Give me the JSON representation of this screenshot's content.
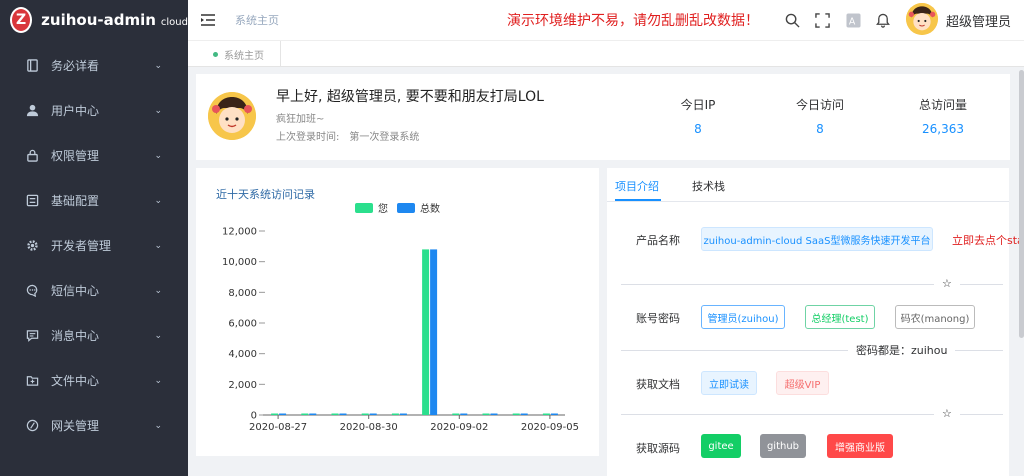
{
  "app": {
    "name": "zuihou-admin",
    "suffix": "cloud",
    "logo_letter": "Z"
  },
  "sidebar": {
    "items": [
      {
        "label": "务必详看",
        "icon": "book-icon"
      },
      {
        "label": "用户中心",
        "icon": "user-icon"
      },
      {
        "label": "权限管理",
        "icon": "lock-icon"
      },
      {
        "label": "基础配置",
        "icon": "config-icon"
      },
      {
        "label": "开发者管理",
        "icon": "gear-icon"
      },
      {
        "label": "短信中心",
        "icon": "sms-icon"
      },
      {
        "label": "消息中心",
        "icon": "message-icon"
      },
      {
        "label": "文件中心",
        "icon": "folder-icon"
      },
      {
        "label": "网关管理",
        "icon": "gateway-icon"
      }
    ]
  },
  "header": {
    "breadcrumb": "系统主页",
    "notice": "演示环境维护不易，请勿乱删乱改数据！",
    "username": "超级管理员",
    "icons": [
      "search-icon",
      "fullscreen-icon",
      "translate-icon",
      "bell-icon"
    ]
  },
  "tagsview": {
    "tags": [
      {
        "label": "系统主页"
      }
    ]
  },
  "welcome": {
    "greeting": "早上好, 超级管理员, 要不要和朋友打局LOL",
    "subtitle": "疯狂加班~",
    "last_login_label": "上次登录时间:",
    "last_login_value": "第一次登录系统",
    "stats": [
      {
        "label": "今日IP",
        "value": "8"
      },
      {
        "label": "今日访问",
        "value": "8"
      },
      {
        "label": "总访问量",
        "value": "26,363"
      }
    ]
  },
  "chart_card": {
    "title": "近十天系统访问记录"
  },
  "chart_data": {
    "type": "bar",
    "categories": [
      "2020-08-27",
      "2020-08-28",
      "2020-08-29",
      "2020-08-30",
      "2020-08-31",
      "2020-09-01",
      "2020-09-02",
      "2020-09-03",
      "2020-09-04",
      "2020-09-05"
    ],
    "series": [
      {
        "name": "您",
        "color": "#2bdf8d",
        "values": [
          8,
          8,
          8,
          0,
          8,
          10800,
          8,
          8,
          8,
          0
        ]
      },
      {
        "name": "总数",
        "color": "#1e88f0",
        "values": [
          8,
          8,
          8,
          0,
          8,
          10800,
          8,
          8,
          8,
          0
        ]
      }
    ],
    "xticks": [
      "2020-08-27",
      "2020-08-30",
      "2020-09-02",
      "2020-09-05"
    ],
    "yticks": [
      "0",
      "2,000",
      "4,000",
      "6,000",
      "8,000",
      "10,000",
      "12,000"
    ],
    "ylim": [
      0,
      12000
    ],
    "legend_position": "top-center"
  },
  "project": {
    "tabs": [
      "项目介绍",
      "技术栈"
    ],
    "rows": {
      "product_label": "产品名称",
      "product_chip": "zuihou-admin-cloud SaaS型微服务快速开发平台",
      "star_text": "立即去点个star吧~",
      "account_label": "账号密码",
      "accounts": [
        "管理员(zuihou)",
        "总经理(test)",
        "码农(manong)"
      ],
      "password_note": "密码都是：",
      "password_value": "zuihou",
      "docs_label": "获取文档",
      "docs": [
        "立即试读",
        "超级VIP"
      ],
      "source_label": "获取源码",
      "sources": [
        "gitee",
        "github",
        "增强商业版"
      ],
      "star_icon": "☆"
    }
  }
}
